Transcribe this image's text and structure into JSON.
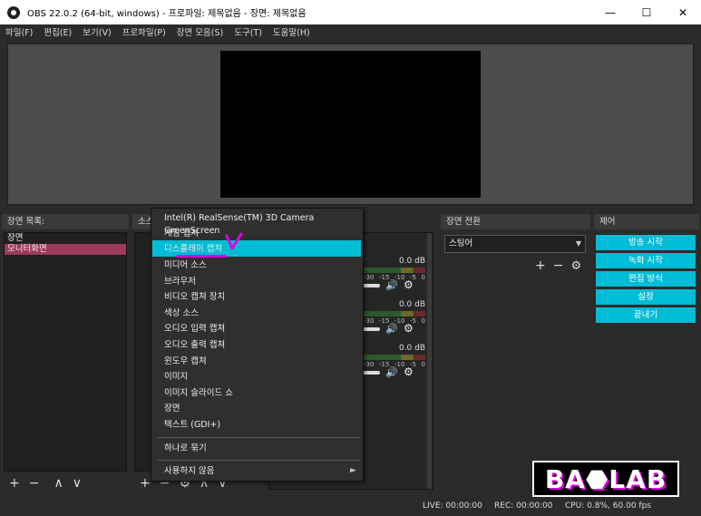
{
  "window": {
    "title": "OBS 22.0.2 (64-bit, windows) - 프로파일: 제목없음 - 장면: 제목없음",
    "min_glyph": "—",
    "max_glyph": "☐",
    "close_glyph": "✕"
  },
  "menu": [
    "파일(F)",
    "편집(E)",
    "보기(V)",
    "프로파일(P)",
    "장면 모음(S)",
    "도구(T)",
    "도움말(H)"
  ],
  "scenes": {
    "title": "장면 목록:",
    "items": [
      "장면",
      "모니터화면"
    ]
  },
  "sources": {
    "title": "소스"
  },
  "context_menu": {
    "items": [
      "Intel(R) RealSense(TM) 3D Camera GreenScreen",
      "게임 캡쳐",
      "디스플레이 캡쳐",
      "미디어 소스",
      "브라우저",
      "비디오 캡쳐 장치",
      "색상 소스",
      "오디오 입력 캡쳐",
      "오디오 출력 캡쳐",
      "윈도우 캡쳐",
      "이미지",
      "이미지 슬라이드 쇼",
      "장면",
      "텍스트 (GDI+)"
    ],
    "group": "하나로 묶기",
    "deprecated": "사용하지 않음"
  },
  "mixer": {
    "tracks": [
      {
        "db": "0.0 dB",
        "ticks": [
          "-30",
          "-15",
          "-10",
          "-5",
          "0"
        ],
        "muted": false
      },
      {
        "db": "0.0 dB",
        "ticks": [
          "-30",
          "-15",
          "-10",
          "-5",
          "0"
        ],
        "muted": false
      },
      {
        "db": "0.0 dB",
        "ticks": [
          "-30",
          "-15",
          "-10",
          "-5",
          "0"
        ],
        "muted": true
      }
    ]
  },
  "transitions": {
    "title": "장면 전환",
    "selected": "스팅어"
  },
  "controls": {
    "title": "제어",
    "buttons": [
      "방송 시작",
      "녹화 시작",
      "편집 방식",
      "설정",
      "끝내기"
    ]
  },
  "status": {
    "live": "LIVE: 00:00:00",
    "rec": "REC: 00:00:00",
    "cpu": "CPU: 0.8%, 60.00 fps"
  },
  "watermark": {
    "text": "BA⬣LAB"
  },
  "colors": {
    "accent": "#00bcd4",
    "selection": "#9b3a5a",
    "pen": "#e000e0"
  },
  "icons": {
    "plus": "+",
    "minus": "−",
    "up": "∧",
    "down": "∨",
    "gear": "⚙",
    "speaker": "🔊",
    "submenu": "►",
    "combo_caret": "▼"
  }
}
